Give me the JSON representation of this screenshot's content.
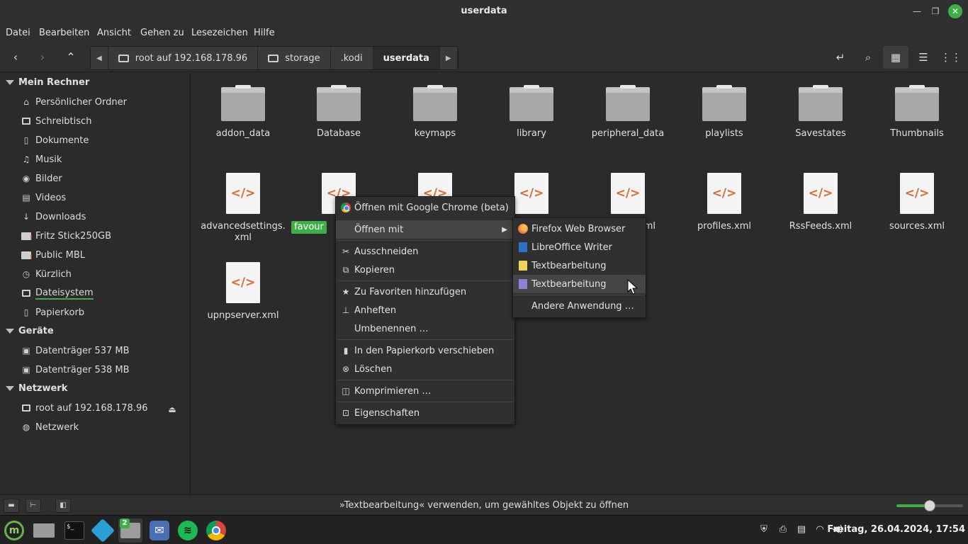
{
  "window": {
    "title": "userdata"
  },
  "menubar": [
    "Datei",
    "Bearbeiten",
    "Ansicht",
    "Gehen zu",
    "Lesezeichen",
    "Hilfe"
  ],
  "breadcrumbs": [
    "root auf 192.168.178.96",
    "storage",
    ".kodi",
    "userdata"
  ],
  "sidebar": {
    "sections": [
      {
        "label": "Mein Rechner"
      },
      {
        "label": "Geräte"
      },
      {
        "label": "Netzwerk"
      }
    ],
    "items": [
      {
        "label": "Persönlicher Ordner",
        "icon": "home-icon"
      },
      {
        "label": "Schreibtisch",
        "icon": "desktop-icon"
      },
      {
        "label": "Dokumente",
        "icon": "document-icon"
      },
      {
        "label": "Musik",
        "icon": "music-icon"
      },
      {
        "label": "Bilder",
        "icon": "camera-icon"
      },
      {
        "label": "Videos",
        "icon": "film-icon"
      },
      {
        "label": "Downloads",
        "icon": "download-icon"
      },
      {
        "label": "Fritz Stick250GB",
        "icon": "folder-warning-icon"
      },
      {
        "label": "Public MBL",
        "icon": "folder-warning-icon"
      },
      {
        "label": "Kürzlich",
        "icon": "clock-icon"
      },
      {
        "label": "Dateisystem",
        "icon": "drive-icon"
      },
      {
        "label": "Papierkorb",
        "icon": "trash-icon"
      },
      {
        "label": "Datenträger 537 MB",
        "icon": "disk-icon"
      },
      {
        "label": "Datenträger 538 MB",
        "icon": "disk-icon"
      },
      {
        "label": "root auf 192.168.178.96",
        "icon": "network-drive-icon"
      },
      {
        "label": "Netzwerk",
        "icon": "globe-icon"
      }
    ]
  },
  "files": {
    "folders": [
      "addon_data",
      "Database",
      "keymaps",
      "library",
      "peripheral_data",
      "playlists",
      "Savestates",
      "Thumbnails"
    ],
    "xml_row": [
      "advancedsettings.\nxml",
      "favour",
      "",
      "",
      "xml",
      "profiles.xml",
      "RssFeeds.xml",
      "sources.xml"
    ],
    "xml_row3": [
      "upnpserver.xml"
    ]
  },
  "context_menu": {
    "items": [
      {
        "label": "Öffnen mit Google Chrome (beta)",
        "icon": "chrome-icon"
      },
      {
        "label": "Öffnen mit",
        "icon": ""
      },
      {
        "label": "Ausschneiden",
        "icon": "scissors-icon"
      },
      {
        "label": "Kopieren",
        "icon": "copy-icon"
      },
      {
        "label": "Zu Favoriten hinzufügen",
        "icon": "star-icon"
      },
      {
        "label": "Anheften",
        "icon": "pin-icon"
      },
      {
        "label": "Umbenennen …",
        "icon": ""
      },
      {
        "label": "In den Papierkorb verschieben",
        "icon": "trash-icon"
      },
      {
        "label": "Löschen",
        "icon": "delete-icon"
      },
      {
        "label": "Komprimieren …",
        "icon": "archive-icon"
      },
      {
        "label": "Eigenschaften",
        "icon": "properties-icon"
      }
    ]
  },
  "submenu": {
    "items": [
      {
        "label": "Firefox Web Browser",
        "icon": "firefox-icon"
      },
      {
        "label": "LibreOffice Writer",
        "icon": "libreoffice-writer-icon"
      },
      {
        "label": "Textbearbeitung",
        "icon": "text-editor-icon"
      },
      {
        "label": "Textbearbeitung",
        "icon": "text-editor-icon"
      },
      {
        "label": "Andere Anwendung …",
        "icon": ""
      }
    ]
  },
  "statusbar": {
    "text": "»Textbearbeitung« verwenden, um gewähltes Objekt zu öffnen",
    "zoom_fraction": 0.5
  },
  "taskbar": {
    "files_badge": "2",
    "clock": "Freitag, 26.04.2024, 17:54"
  },
  "colors": {
    "accent": "#3fae49",
    "xml_icon": "#e0672e"
  }
}
